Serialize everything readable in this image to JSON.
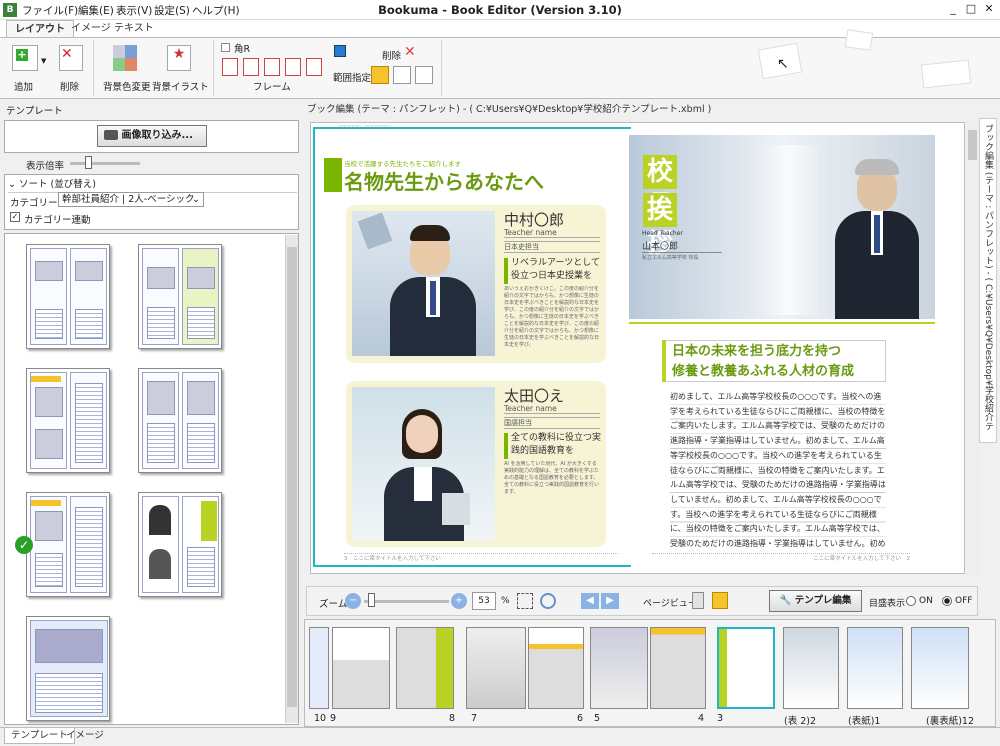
{
  "app": {
    "title": "Bookuma - Book Editor (Version 3.10)",
    "icon_text": "B"
  },
  "menu": [
    "ファイル(F)",
    "編集(E)",
    "表示(V)",
    "設定(S)",
    "ヘルプ(H)"
  ],
  "window_buttons": [
    "_",
    "□",
    "✕"
  ],
  "ribbon_tabs": [
    "レイアウト",
    "イメージ",
    "テキスト"
  ],
  "ribbon": {
    "add": "追加",
    "delete": "削除",
    "bg_color": "背景色変更",
    "bg_illust": "背景イラスト",
    "kado": "角R",
    "frame": "フレーム",
    "range": "範囲指定",
    "del2": "削除"
  },
  "left": {
    "panel_title": "テンプレート",
    "import_button": "画像取り込み...",
    "zoom_label": "表示倍率",
    "sort_label": "ソート (並び替え)",
    "category_label": "カテゴリー",
    "category_value": "幹部社員紹介 | 2人-ベーシック",
    "link_label": "カテゴリー連動",
    "zoom_level": 0.25
  },
  "bottom_tabs": [
    "テンプレート",
    "イメージ"
  ],
  "editor": {
    "header": "ブック編集 (テーマ : パンフレット) - ( C:¥Users¥Q¥Desktop¥学校紹介テンプレート.xbml )",
    "side_title": "ブック編集 (テーマ : パンフレット) - ( C:¥Users¥Q¥Desktop¥学校紹介テンプレート.xbml )"
  },
  "page_left": {
    "sub": "当校で活躍する先生たちをご紹介します",
    "title": "名物先生からあなたへ",
    "t1": {
      "name": "中村〇郎",
      "en": "Teacher name",
      "dept": "日本史担当",
      "head": "リベラルアーツとして役立つ日本史授業を",
      "body": "あいうえおかきくけこ。この度の紹介分を紹介の文字ではからも、かつ想像に生徒の日本史を学ぶべきことを解説的な日本史を学び、この度の紹介分を紹介の文字ではからも、かつ想像に生徒の日本史を学ぶべきことを解説的な日本史を学び、この度の紹介分を紹介の文字ではからも、かつ想像に生徒の日本史を学ぶべきことを解説的な日本史を学び。"
    },
    "t2": {
      "name": "太田〇え",
      "en": "Teacher name",
      "dept": "国語担当",
      "head": "全ての教科に役立つ実践的国語教育を",
      "body": "AI を活用していた現代、AI が大きくする実践的能力の理解は、全ての教科を学ぶための基礎となる国語教育を必要とします。全ての教科に役立つ実践的国語教育を行います。"
    },
    "footer": "3　ここに章タイトルを入力して下さい"
  },
  "page_right": {
    "title1": "校長",
    "title2": "挨拶",
    "head_en": "Head Teacher",
    "head_name": "山本〇郎",
    "head_small": "私立エルム高等学校 校長",
    "heading1": "日本の未来を担う底力を持つ",
    "heading2": "修養と教養あふれる人材の育成",
    "body": "初めまして、エルム高等学校校長の○○○です。当校への進学を考えられている生徒ならびにご両親様に、当校の特徴をご案内いたします。エルム高等学校では、受験のためだけの進路指導・学業指導はしていません。初めまして、エルム高等学校校長の○○○です。当校への進学を考えられている生徒ならびにご両親様に、当校の特徴をご案内いたします。エルム高等学校では、受験のためだけの進路指導・学業指導はしていません。初めまして、エルム高等学校校長の○○○です。当校への進学を考えられている生徒ならびにご両親様に、当校の特徴をご案内いたします。エルム高等学校では、受験のためだけの進路指導・学業指導はしていません。初めまして、エルム高等学校校長の○○○です。当校への進学を考えられている生徒ならびにご両親様に、当校の特徴をご案内いたします。",
    "footer": "ここに章タイトルを入力して下さい　2"
  },
  "zoombar": {
    "label": "ズーム",
    "value": "53",
    "pct": "%",
    "pageview": "ページビュー",
    "template_edit": "テンプレ編集",
    "spread": "目盛表示",
    "on": "ON",
    "off": "OFF",
    "zoom_level": 0.53
  },
  "strip": {
    "numbers": [
      "10",
      "9",
      "8",
      "7",
      "6",
      "5",
      "4",
      "3",
      "(表 2)2",
      "(表紙)1",
      "(裏表紙)12"
    ]
  },
  "colors": {
    "accent": "#b9d223",
    "canvas_border": "#1fb6c9",
    "title_green": "#6a9a0f"
  }
}
